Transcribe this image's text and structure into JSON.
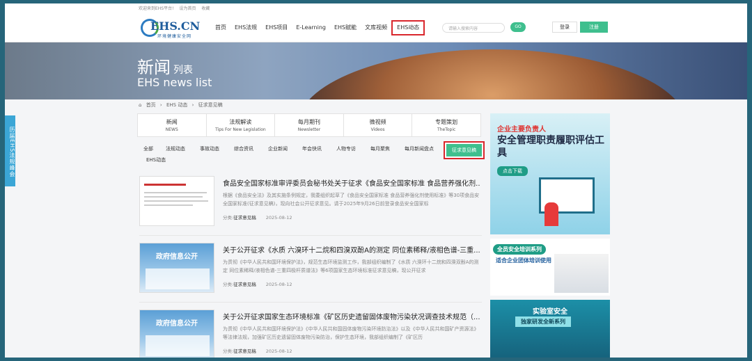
{
  "topbar": {
    "links": [
      "欢迎来到EHS平台!",
      "设为首页",
      "收藏"
    ]
  },
  "logo": {
    "word": "EHS.CN",
    "sub": "环境健康安全网"
  },
  "nav": {
    "items": [
      "首页",
      "EHS法规",
      "EHS项目",
      "E-Learning",
      "EHS赋能",
      "文库视频",
      "EHS动态"
    ],
    "active": "EHS动态"
  },
  "search": {
    "placeholder": "请输入搜索内容",
    "go": "GO"
  },
  "auth": {
    "login": "登录",
    "register": "注册"
  },
  "banner": {
    "title": "新闻",
    "title_small": "列表",
    "subtitle": "EHS news list"
  },
  "sidetab": {
    "label": "历届EHS法规峰会"
  },
  "breadcrumb": [
    "首页",
    "EHS 动态",
    "征求意见稿"
  ],
  "category_tabs": [
    {
      "cn": "新闻",
      "en": "NEWS"
    },
    {
      "cn": "法规解读",
      "en": "Tips For New Legislation"
    },
    {
      "cn": "每月期刊",
      "en": "Newsletter"
    },
    {
      "cn": "微视频",
      "en": "Videos"
    },
    {
      "cn": "专题策划",
      "en": "TheTopic"
    }
  ],
  "filters": [
    "全部",
    "法规动态",
    "事故动态",
    "综合资讯",
    "企业新闻",
    "年会快讯",
    "人物专访",
    "每月聚焦",
    "每月新闻盘点",
    "征求意见稿",
    "EHS动态"
  ],
  "active_filter": "征求意见稿",
  "articles": [
    {
      "title": "食品安全国家标准审评委员会秘书处关于征求《食品安全国家标准 食品营养强化剂...",
      "desc": "根据《食品安全法》及其实施条例规定，我委组织起草了《食品安全国家标准 食品营养强化剂使用标准》等30项食品安全国家标准(征求意见稿)，现向社会公开征求意见。请于2025年9月26日前登录食品安全国家标",
      "category_label": "分类:",
      "category": "征求意见稿",
      "date": "2025-08-12"
    },
    {
      "title": "关于公开征求《水质 六溴环十二烷和四溴双酚A的测定 同位素稀释/液相色谱-三重...",
      "desc": "为贯彻《中华人民共和国环境保护法》，规范生态环境监测工作，我部组织编制了《水质 六溴环十二烷和四溴双酚A的测定 同位素稀释/液相色谱-三重四极杆质谱法》等6项国家生态环境标准征求意见稿，现公开征求",
      "category_label": "分类:",
      "category": "征求意见稿",
      "date": "2025-08-12"
    },
    {
      "title": "关于公开征求国家生态环境标准《矿区历史遗留固体废物污染状况调查技术规范（...",
      "desc": "为贯彻《中华人民共和国环境保护法》《中华人民共和国固体废物污染环境防治法》以及《中华人民共和国矿产资源法》等法律法规，加强矿区历史遗留固体废物污染防治，保护生态环境，我部组织编制了《矿区历",
      "category_label": "分类:",
      "category": "征求意见稿",
      "date": "2025-08-12"
    }
  ],
  "thumb_gov_text": "政府信息公开",
  "ads": {
    "ad1": {
      "tag": "企业主要负责人",
      "title": "安全管理职责履职评估工具",
      "btn": "点击下载"
    },
    "ad2": {
      "tag": "全员安全培训系列",
      "text": "适合企业团体培训使用"
    },
    "ad3": {
      "title": "实验室安全",
      "tag": "独家研发全新系列"
    }
  },
  "colors": {
    "accent": "#3fbf8e",
    "highlight": "#d9262c",
    "frame": "#26657a"
  }
}
